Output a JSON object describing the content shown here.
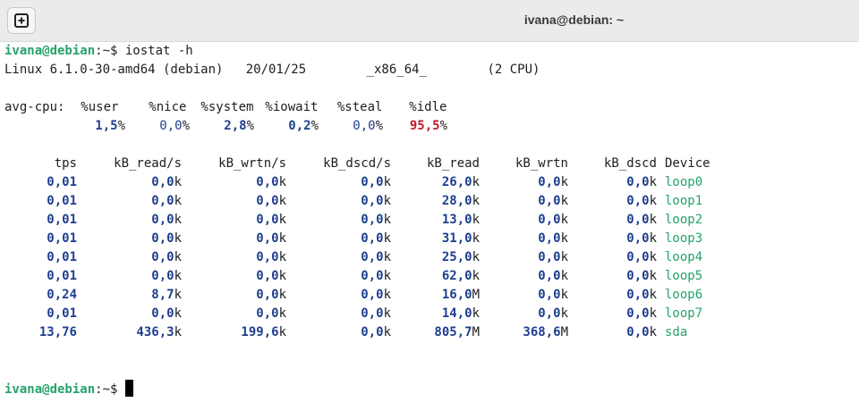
{
  "window": {
    "title": "ivana@debian: ~",
    "new_tab_icon": "plus-square-icon"
  },
  "terminal": {
    "prompt_user": "ivana@debian",
    "prompt_path": ":~$ ",
    "command": "iostat -h",
    "sysinfo": "Linux 6.1.0-30-amd64 (debian)   20/01/25        _x86_64_        (2 CPU)",
    "cpu": {
      "label": "avg-cpu:",
      "headers": [
        "%user",
        "%nice",
        "%system",
        "%iowait",
        "%steal",
        "%idle"
      ],
      "values": [
        "1,5",
        "0,0",
        "2,8",
        "0,2",
        "0,0",
        "95,5"
      ]
    },
    "device_table": {
      "headers": [
        "tps",
        "kB_read/s",
        "kB_wrtn/s",
        "kB_dscd/s",
        "kB_read",
        "kB_wrtn",
        "kB_dscd",
        "Device"
      ],
      "rows": [
        [
          [
            "0,01",
            ""
          ],
          [
            "0,0",
            "k"
          ],
          [
            "0,0",
            "k"
          ],
          [
            "0,0",
            "k"
          ],
          [
            "26,0",
            "k"
          ],
          [
            "0,0",
            "k"
          ],
          [
            "0,0",
            "k"
          ],
          "loop0"
        ],
        [
          [
            "0,01",
            ""
          ],
          [
            "0,0",
            "k"
          ],
          [
            "0,0",
            "k"
          ],
          [
            "0,0",
            "k"
          ],
          [
            "28,0",
            "k"
          ],
          [
            "0,0",
            "k"
          ],
          [
            "0,0",
            "k"
          ],
          "loop1"
        ],
        [
          [
            "0,01",
            ""
          ],
          [
            "0,0",
            "k"
          ],
          [
            "0,0",
            "k"
          ],
          [
            "0,0",
            "k"
          ],
          [
            "13,0",
            "k"
          ],
          [
            "0,0",
            "k"
          ],
          [
            "0,0",
            "k"
          ],
          "loop2"
        ],
        [
          [
            "0,01",
            ""
          ],
          [
            "0,0",
            "k"
          ],
          [
            "0,0",
            "k"
          ],
          [
            "0,0",
            "k"
          ],
          [
            "31,0",
            "k"
          ],
          [
            "0,0",
            "k"
          ],
          [
            "0,0",
            "k"
          ],
          "loop3"
        ],
        [
          [
            "0,01",
            ""
          ],
          [
            "0,0",
            "k"
          ],
          [
            "0,0",
            "k"
          ],
          [
            "0,0",
            "k"
          ],
          [
            "25,0",
            "k"
          ],
          [
            "0,0",
            "k"
          ],
          [
            "0,0",
            "k"
          ],
          "loop4"
        ],
        [
          [
            "0,01",
            ""
          ],
          [
            "0,0",
            "k"
          ],
          [
            "0,0",
            "k"
          ],
          [
            "0,0",
            "k"
          ],
          [
            "62,0",
            "k"
          ],
          [
            "0,0",
            "k"
          ],
          [
            "0,0",
            "k"
          ],
          "loop5"
        ],
        [
          [
            "0,24",
            ""
          ],
          [
            "8,7",
            "k"
          ],
          [
            "0,0",
            "k"
          ],
          [
            "0,0",
            "k"
          ],
          [
            "16,0",
            "M"
          ],
          [
            "0,0",
            "k"
          ],
          [
            "0,0",
            "k"
          ],
          "loop6"
        ],
        [
          [
            "0,01",
            ""
          ],
          [
            "0,0",
            "k"
          ],
          [
            "0,0",
            "k"
          ],
          [
            "0,0",
            "k"
          ],
          [
            "14,0",
            "k"
          ],
          [
            "0,0",
            "k"
          ],
          [
            "0,0",
            "k"
          ],
          "loop7"
        ],
        [
          [
            "13,76",
            ""
          ],
          [
            "436,3",
            "k"
          ],
          [
            "199,6",
            "k"
          ],
          [
            "0,0",
            "k"
          ],
          [
            "805,7",
            "M"
          ],
          [
            "368,6",
            "M"
          ],
          [
            "0,0",
            "k"
          ],
          "sda"
        ]
      ]
    }
  },
  "colors": {
    "prompt": "#26a269",
    "value": "#1e3f8f",
    "idle": "#c01c28",
    "device": "#26a269"
  }
}
